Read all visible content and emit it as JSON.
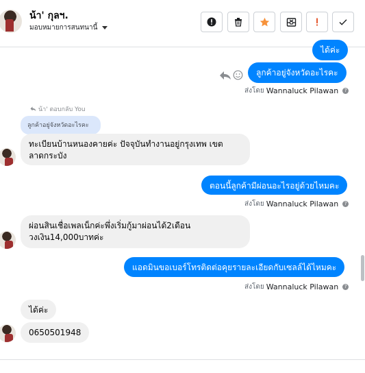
{
  "header": {
    "contact_name": "น้า' กุลฯ.",
    "assign_label": "มอบหมายการสนทนานี้",
    "toolbar": [
      {
        "name": "alert-circle-button",
        "icon": "exclamation-circle-icon"
      },
      {
        "name": "delete-button",
        "icon": "trash-icon"
      },
      {
        "name": "star-button",
        "icon": "star-icon",
        "color": "#f7923a"
      },
      {
        "name": "archive-button",
        "icon": "envelope-x-icon"
      },
      {
        "name": "spam-button",
        "icon": "exclamation-icon",
        "color": "#e4572e"
      },
      {
        "name": "done-button",
        "icon": "check-icon"
      }
    ]
  },
  "messages": {
    "m0_text": "ได้ค่ะ",
    "m1_text": "ลูกค้าอยู่จังหวัดอะไรคะ",
    "m1_sent_by_prefix": "ส่งโดย",
    "m1_sent_by_name": "Wannaluck Pilawan",
    "reply_label": "น้า' ตอบกลับ You",
    "reply_quote": "ลูกค้าอยู่จังหวัดอะไรคะ",
    "m2_line1": "ทะเบียนบ้านหนองคายค่ะ ปัจจุบันทำงานอยู่กรุงเทพ เขต",
    "m2_line2": "ลาดกระบัง",
    "m3_text": "ตอนนี้ลูกค้ามีผ่อนอะไรอยู่ด้วยไหมคะ",
    "m3_sent_by_prefix": "ส่งโดย",
    "m3_sent_by_name": "Wannaluck Pilawan",
    "m4_line1": "ผ่อนสินเชื่อเพลเน็กค่ะพึ่งเริ่มกู้มาผ่อนได้2เดือน",
    "m4_line2": "วงเงิน14,000บาทค่ะ",
    "m5_text": "แอดมินขอเบอร์โทรติดต่อคุยรายละเอียดกับเซลล์ได้ไหมคะ",
    "m5_sent_by_prefix": "ส่งโดย",
    "m5_sent_by_name": "Wannaluck Pilawan",
    "m6_text": "ได้ค่ะ",
    "m7_text": "0650501948"
  },
  "colors": {
    "outgoing": "#0084ff",
    "incoming": "#f0f0f0",
    "quote": "#dbe7fb"
  }
}
